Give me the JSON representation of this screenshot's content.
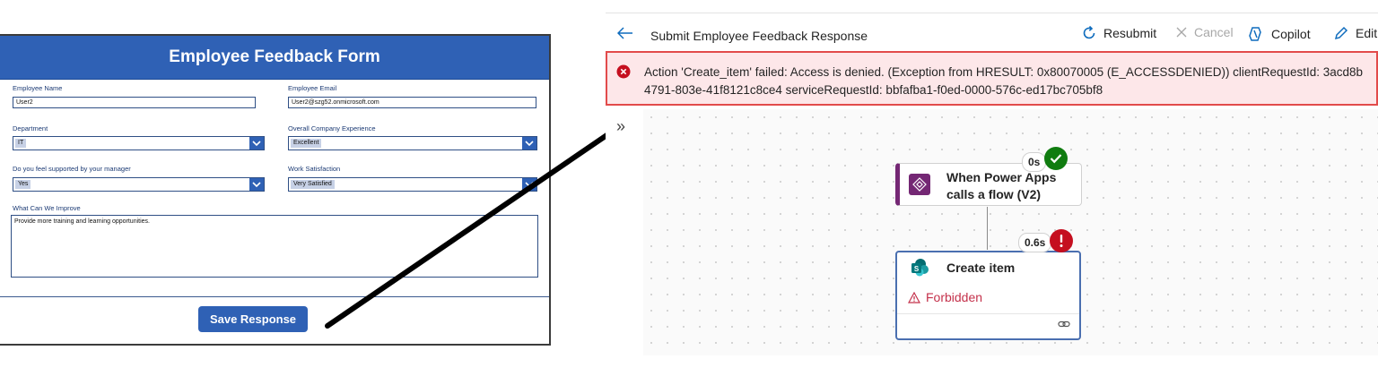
{
  "form": {
    "title": "Employee Feedback Form",
    "fields": {
      "employee_name": {
        "label": "Employee Name",
        "value": "User2"
      },
      "employee_email": {
        "label": "Employee Email",
        "value": "User2@szg52.onmicrosoft.com"
      },
      "department": {
        "label": "Department",
        "value": "IT"
      },
      "company_experience": {
        "label": "Overall Company Experience",
        "value": "Excellent"
      },
      "manager_support": {
        "label": "Do you feel supported by your manager",
        "value": "Yes"
      },
      "work_satisfaction": {
        "label": "Work Satisfaction",
        "value": "Very Satisfied"
      },
      "improve": {
        "label": "What Can We Improve",
        "value": "Provide more training and learning opportunities."
      }
    },
    "save_label": "Save Response"
  },
  "flow": {
    "title": "Submit Employee Feedback Response",
    "toolbar": {
      "resubmit": "Resubmit",
      "cancel": "Cancel",
      "copilot": "Copilot",
      "edit": "Edit"
    },
    "error": {
      "line1": "Action 'Create_item' failed: Access is denied. (Exception from HRESULT: 0x80070005 (E_ACCESSDENIED)) clientRequestId: 3acd8b",
      "line2": "4791-803e-41f8121c8ce4 serviceRequestId: bbfafba1-f0ed-0000-576c-ed17bc705bf8"
    },
    "trigger": {
      "title": "When Power Apps calls a flow (V2)",
      "duration": "0s",
      "status": "succeeded",
      "accent": "#742774"
    },
    "action": {
      "title": "Create item",
      "duration": "0.6s",
      "status": "failed",
      "status_text": "Forbidden",
      "accent": "#036c70"
    }
  },
  "colors": {
    "form_header": "#2f61b5",
    "error_border": "#e24b4b",
    "error_bg": "#fde7e9",
    "success": "#107c10",
    "failure": "#c50f1f"
  }
}
